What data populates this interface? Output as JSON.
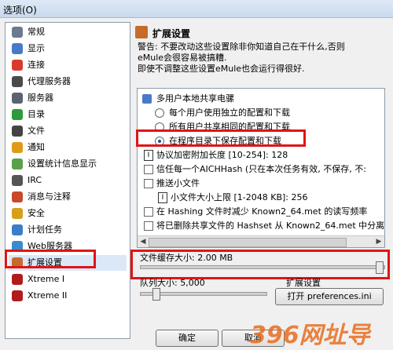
{
  "window": {
    "title": "选项(O)"
  },
  "sidebar": {
    "items": [
      {
        "label": "常规",
        "icon": "wrench-icon",
        "color": "#6b7a8f"
      },
      {
        "label": "显示",
        "icon": "monitor-icon",
        "color": "#4a79c8"
      },
      {
        "label": "连接",
        "icon": "connection-icon",
        "color": "#d93a2b"
      },
      {
        "label": "代理服务器",
        "icon": "proxy-icon",
        "color": "#4a4a4a"
      },
      {
        "label": "服务器",
        "icon": "server-icon",
        "color": "#5a6470"
      },
      {
        "label": "目录",
        "icon": "folder-icon",
        "color": "#2e9a3a"
      },
      {
        "label": "文件",
        "icon": "file-icon",
        "color": "#444444"
      },
      {
        "label": "通知",
        "icon": "bell-icon",
        "color": "#e09a1a"
      },
      {
        "label": "设置统计信息显示",
        "icon": "stats-icon",
        "color": "#5aa04a"
      },
      {
        "label": "IRC",
        "icon": "irc-icon",
        "color": "#555555"
      },
      {
        "label": "消息与注释",
        "icon": "message-icon",
        "color": "#c94a2a"
      },
      {
        "label": "安全",
        "icon": "lock-icon",
        "color": "#d6a01a"
      },
      {
        "label": "计划任务",
        "icon": "clock-icon",
        "color": "#3a7ec8"
      },
      {
        "label": "Web服务器",
        "icon": "globe-icon",
        "color": "#3a8ad0"
      },
      {
        "label": "扩展设置",
        "icon": "extension-icon",
        "color": "#c86a2a"
      },
      {
        "label": "Xtreme I",
        "icon": "xtreme-icon",
        "color": "#b01c1c"
      },
      {
        "label": "Xtreme II",
        "icon": "xtreme-icon",
        "color": "#b01c1c"
      }
    ]
  },
  "panel": {
    "title": "扩展设置",
    "warning": [
      "警告: 不要改动这些设置除非你知道自己在干什么,否则",
      "eMule会很容易被搞糟.",
      "即使不调整这些设置eMule也会运行得很好."
    ]
  },
  "options": {
    "group_label": "多用户本地共享电骡",
    "radios": [
      {
        "label": "每个用户使用独立的配置和下载",
        "checked": false
      },
      {
        "label": "所有用户共享相同的配置和下载",
        "checked": false
      },
      {
        "label": "在程序目录下保存配置和下载",
        "checked": true
      }
    ],
    "rows": [
      {
        "label": "协议加密附加长度 [10-254]: 128",
        "kind": "value"
      },
      {
        "label": "信任每一个AICHHash (只在本次任务有效, 不保存, 不:",
        "kind": "checkbox"
      },
      {
        "label": "推送小文件",
        "kind": "checkbox"
      },
      {
        "label": "小文件大小上限 [1-2048 KB]: 256",
        "kind": "value"
      },
      {
        "label": "在 Hashing 文件时减少 Known2_64.met 的读写频率",
        "kind": "checkbox"
      },
      {
        "label": "将已删除共享文件的 Hashset 从 Known2_64.met 中分离",
        "kind": "checkbox"
      }
    ]
  },
  "sliders": {
    "file_buffer": {
      "label": "文件缓存大小: 2.00 MB",
      "position": 0.98
    },
    "queue_size": {
      "label": "队列大小: 5,000",
      "position": 0.1
    },
    "ext_label": "扩展设置"
  },
  "buttons": {
    "open_prefs": "打开 preferences.ini",
    "ok": "确定",
    "cancel": "取消"
  },
  "watermark": "396网址导"
}
